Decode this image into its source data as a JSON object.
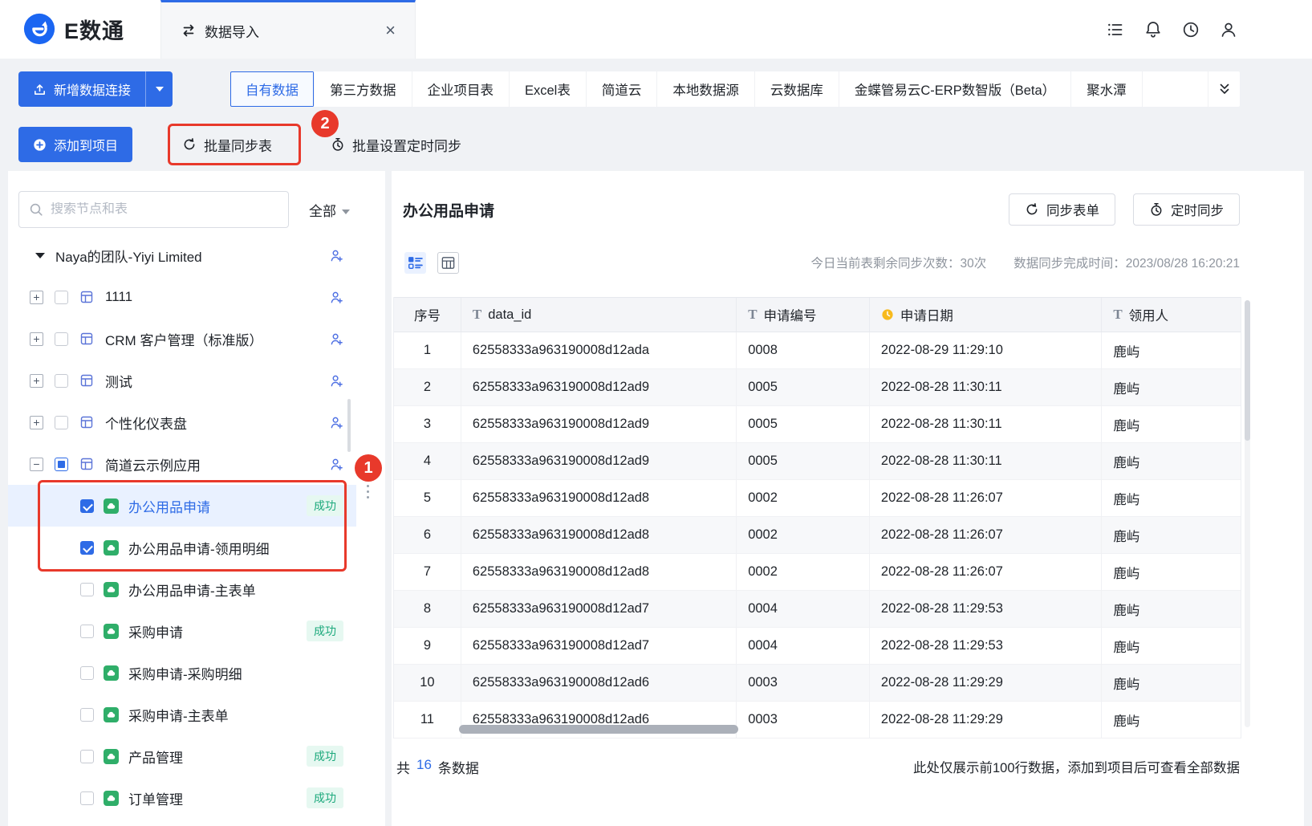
{
  "colors": {
    "primary": "#2E6BE6",
    "annotation_red": "#E8392B",
    "success_green": "#1CA97C",
    "cloud_green": "#2FAE69"
  },
  "header": {
    "logo_text": "E数通",
    "tab_label": "数据导入",
    "tab_close": "×",
    "icons": [
      "task-list-icon",
      "bell-icon",
      "history-icon",
      "user-icon"
    ]
  },
  "toolbar": {
    "new_connection_label": "新增数据连接",
    "source_tabs": [
      "自有数据",
      "第三方数据",
      "企业项目表",
      "Excel表",
      "简道云",
      "本地数据源",
      "云数据库",
      "金蝶管易云C-ERP数智版（Beta）",
      "聚水潭"
    ],
    "active_source_tab": "自有数据",
    "add_to_project_label": "添加到项目",
    "batch_sync_label": "批量同步表",
    "batch_schedule_label": "批量设置定时同步"
  },
  "sidebar": {
    "search_placeholder": "搜索节点和表",
    "filter_label": "全部",
    "tree": {
      "nodes": [
        {
          "type": "root",
          "label": "Naya的团队-Yiyi Limited"
        },
        {
          "type": "app",
          "label": "1111"
        },
        {
          "type": "app",
          "label": "CRM 客户管理（标准版）"
        },
        {
          "type": "app",
          "label": "测试"
        },
        {
          "type": "app",
          "label": "个性化仪表盘"
        },
        {
          "type": "app",
          "label": "简道云示例应用",
          "expanded": true,
          "indeterminate": true
        },
        {
          "type": "form",
          "label": "办公用品申请",
          "checked": true,
          "selected": true,
          "badge": "成功"
        },
        {
          "type": "form",
          "label": "办公用品申请-领用明细",
          "checked": true
        },
        {
          "type": "form",
          "label": "办公用品申请-主表单"
        },
        {
          "type": "form",
          "label": "采购申请",
          "badge": "成功"
        },
        {
          "type": "form",
          "label": "采购申请-采购明细"
        },
        {
          "type": "form",
          "label": "采购申请-主表单"
        },
        {
          "type": "form",
          "label": "产品管理",
          "badge": "成功"
        },
        {
          "type": "form",
          "label": "订单管理",
          "badge": "成功"
        }
      ]
    }
  },
  "main": {
    "title": "办公用品申请",
    "sync_form_label": "同步表单",
    "schedule_sync_label": "定时同步",
    "sync_quota_text": "今日当前表剩余同步次数：30次",
    "sync_time_text": "数据同步完成时间：2023/08/28 16:20:21",
    "table": {
      "columns": [
        "序号",
        "data_id",
        "申请编号",
        "申请日期",
        "领用人"
      ],
      "rows": [
        [
          "1",
          "62558333a963190008d12ada",
          "0008",
          "2022-08-29 11:29:10",
          "鹿屿"
        ],
        [
          "2",
          "62558333a963190008d12ad9",
          "0005",
          "2022-08-28 11:30:11",
          "鹿屿"
        ],
        [
          "3",
          "62558333a963190008d12ad9",
          "0005",
          "2022-08-28 11:30:11",
          "鹿屿"
        ],
        [
          "4",
          "62558333a963190008d12ad9",
          "0005",
          "2022-08-28 11:30:11",
          "鹿屿"
        ],
        [
          "5",
          "62558333a963190008d12ad8",
          "0002",
          "2022-08-28 11:26:07",
          "鹿屿"
        ],
        [
          "6",
          "62558333a963190008d12ad8",
          "0002",
          "2022-08-28 11:26:07",
          "鹿屿"
        ],
        [
          "7",
          "62558333a963190008d12ad8",
          "0002",
          "2022-08-28 11:26:07",
          "鹿屿"
        ],
        [
          "8",
          "62558333a963190008d12ad7",
          "0004",
          "2022-08-28 11:29:53",
          "鹿屿"
        ],
        [
          "9",
          "62558333a963190008d12ad7",
          "0004",
          "2022-08-28 11:29:53",
          "鹿屿"
        ],
        [
          "10",
          "62558333a963190008d12ad6",
          "0003",
          "2022-08-28 11:29:29",
          "鹿屿"
        ],
        [
          "11",
          "62558333a963190008d12ad6",
          "0003",
          "2022-08-28 11:29:29",
          "鹿屿"
        ]
      ]
    },
    "footer": {
      "total_prefix": "共",
      "total_count": "16",
      "total_suffix": "条数据",
      "note": "此处仅展示前100行数据，添加到项目后可查看全部数据"
    }
  },
  "annotations": {
    "step1": "1",
    "step2": "2"
  }
}
